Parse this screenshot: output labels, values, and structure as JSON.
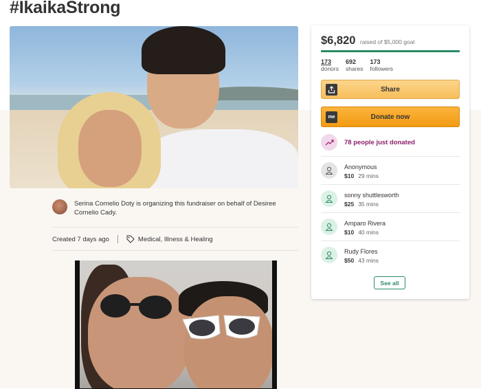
{
  "page": {
    "title": "#IkaikaStrong"
  },
  "organizer": {
    "text": "Serina Cornelio Doty is organizing this fundraiser on behalf of Desiree Cornelio Cady.",
    "created": "Created 7 days ago",
    "category": "Medical, Illness & Healing"
  },
  "donation_card": {
    "amount": "$6,820",
    "goal_text": "raised of $5,000 goal",
    "progress_fraction": 1.0,
    "stats": [
      {
        "value": "173",
        "label": "donors"
      },
      {
        "value": "692",
        "label": "shares"
      },
      {
        "value": "173",
        "label": "followers"
      }
    ],
    "share_label": "Share",
    "donate_label": "Donate now",
    "donate_icon_text": "me",
    "trend_text": "78 people just donated",
    "donations": [
      {
        "name": "Anonymous",
        "amount": "$10",
        "time": "29 mins",
        "anonymous": true
      },
      {
        "name": "sonny shuttlesworth",
        "amount": "$25",
        "time": "35 mins",
        "anonymous": false
      },
      {
        "name": "Amparo Rivera",
        "amount": "$10",
        "time": "40 mins",
        "anonymous": false
      },
      {
        "name": "Rudy Flores",
        "amount": "$50",
        "time": "43 mins",
        "anonymous": false
      }
    ],
    "see_all_label": "See all"
  },
  "colors": {
    "accent_green": "#2a8a64",
    "donate_orange": "#f29b12",
    "share_yellow": "#f7be5b",
    "trend_purple": "#8a1f6a"
  }
}
